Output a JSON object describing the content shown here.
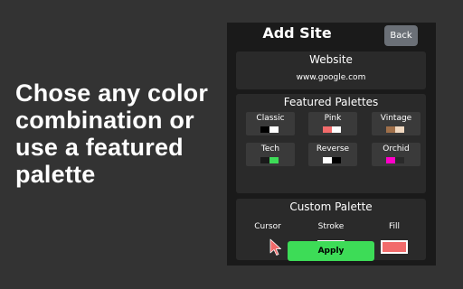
{
  "promo": {
    "lines": [
      "Chose any color",
      "combination or",
      "use a featured",
      "palette"
    ]
  },
  "popup": {
    "title": "Add Site",
    "back_label": "Back"
  },
  "website": {
    "heading": "Website",
    "value": "www.google.com"
  },
  "featured": {
    "heading": "Featured Palettes",
    "palettes": [
      {
        "name": "Classic",
        "colors": [
          "#000000",
          "#ffffff"
        ]
      },
      {
        "name": "Pink",
        "colors": [
          "#f26b6b",
          "#ffffff"
        ]
      },
      {
        "name": "Vintage",
        "colors": [
          "#a0704a",
          "#f0d8c0"
        ]
      },
      {
        "name": "Tech",
        "colors": [
          "#1a1a1a",
          "#3ddc57"
        ]
      },
      {
        "name": "Reverse",
        "colors": [
          "#ffffff",
          "#000000"
        ]
      },
      {
        "name": "Orchid",
        "colors": [
          "#ff00c8",
          "#2a2a2a"
        ]
      }
    ]
  },
  "custom": {
    "heading": "Custom Palette",
    "cursor_label": "Cursor",
    "stroke_label": "Stroke",
    "fill_label": "Fill",
    "stroke_color": "#ffffff",
    "fill_color": "#f26b6b",
    "cursor_color": "#f26b6b"
  },
  "apply_label": "Apply",
  "colors": {
    "background": "#333333",
    "popup_bg": "#1a1a1a",
    "panel_bg": "#2a2a2a",
    "apply_green": "#3ddc57",
    "back_gray": "#6b7077"
  }
}
